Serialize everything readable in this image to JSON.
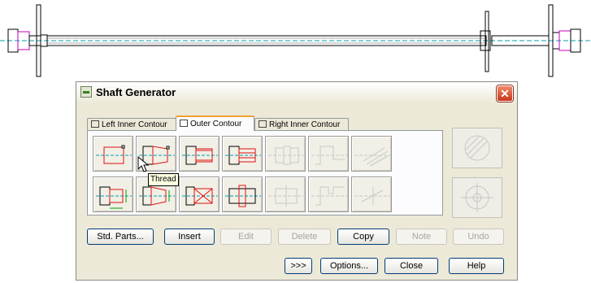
{
  "dialog": {
    "title": "Shaft Generator",
    "close_glyph": "✕"
  },
  "tabs": [
    {
      "label": "Left Inner Contour",
      "icon": "left-inner-contour-icon"
    },
    {
      "label": "Outer Contour",
      "icon": "outer-contour-icon"
    },
    {
      "label": "Right Inner Contour",
      "icon": "right-inner-contour-icon"
    }
  ],
  "tools_row1": [
    "cylinder",
    "cone",
    "thread",
    "polygon",
    "tool-disabled",
    "tool-disabled",
    "tool-disabled"
  ],
  "tools_row2": [
    "cylinder-measure",
    "cone-measure",
    "cut-cross",
    "insert-section",
    "tool-disabled",
    "tool-disabled",
    "tool-disabled"
  ],
  "tooltip": "Thread",
  "buttons": {
    "std_parts": "Std. Parts...",
    "insert": "Insert",
    "edit": "Edit",
    "delete": "Delete",
    "copy": "Copy",
    "note": "Note",
    "undo": "Undo",
    "more": ">>>",
    "options": "Options...",
    "close": "Close",
    "help": "Help"
  },
  "colors": {
    "accent_red": "#e01010",
    "centerline": "#00a0b0",
    "shaft_magenta": "#c000c0"
  }
}
